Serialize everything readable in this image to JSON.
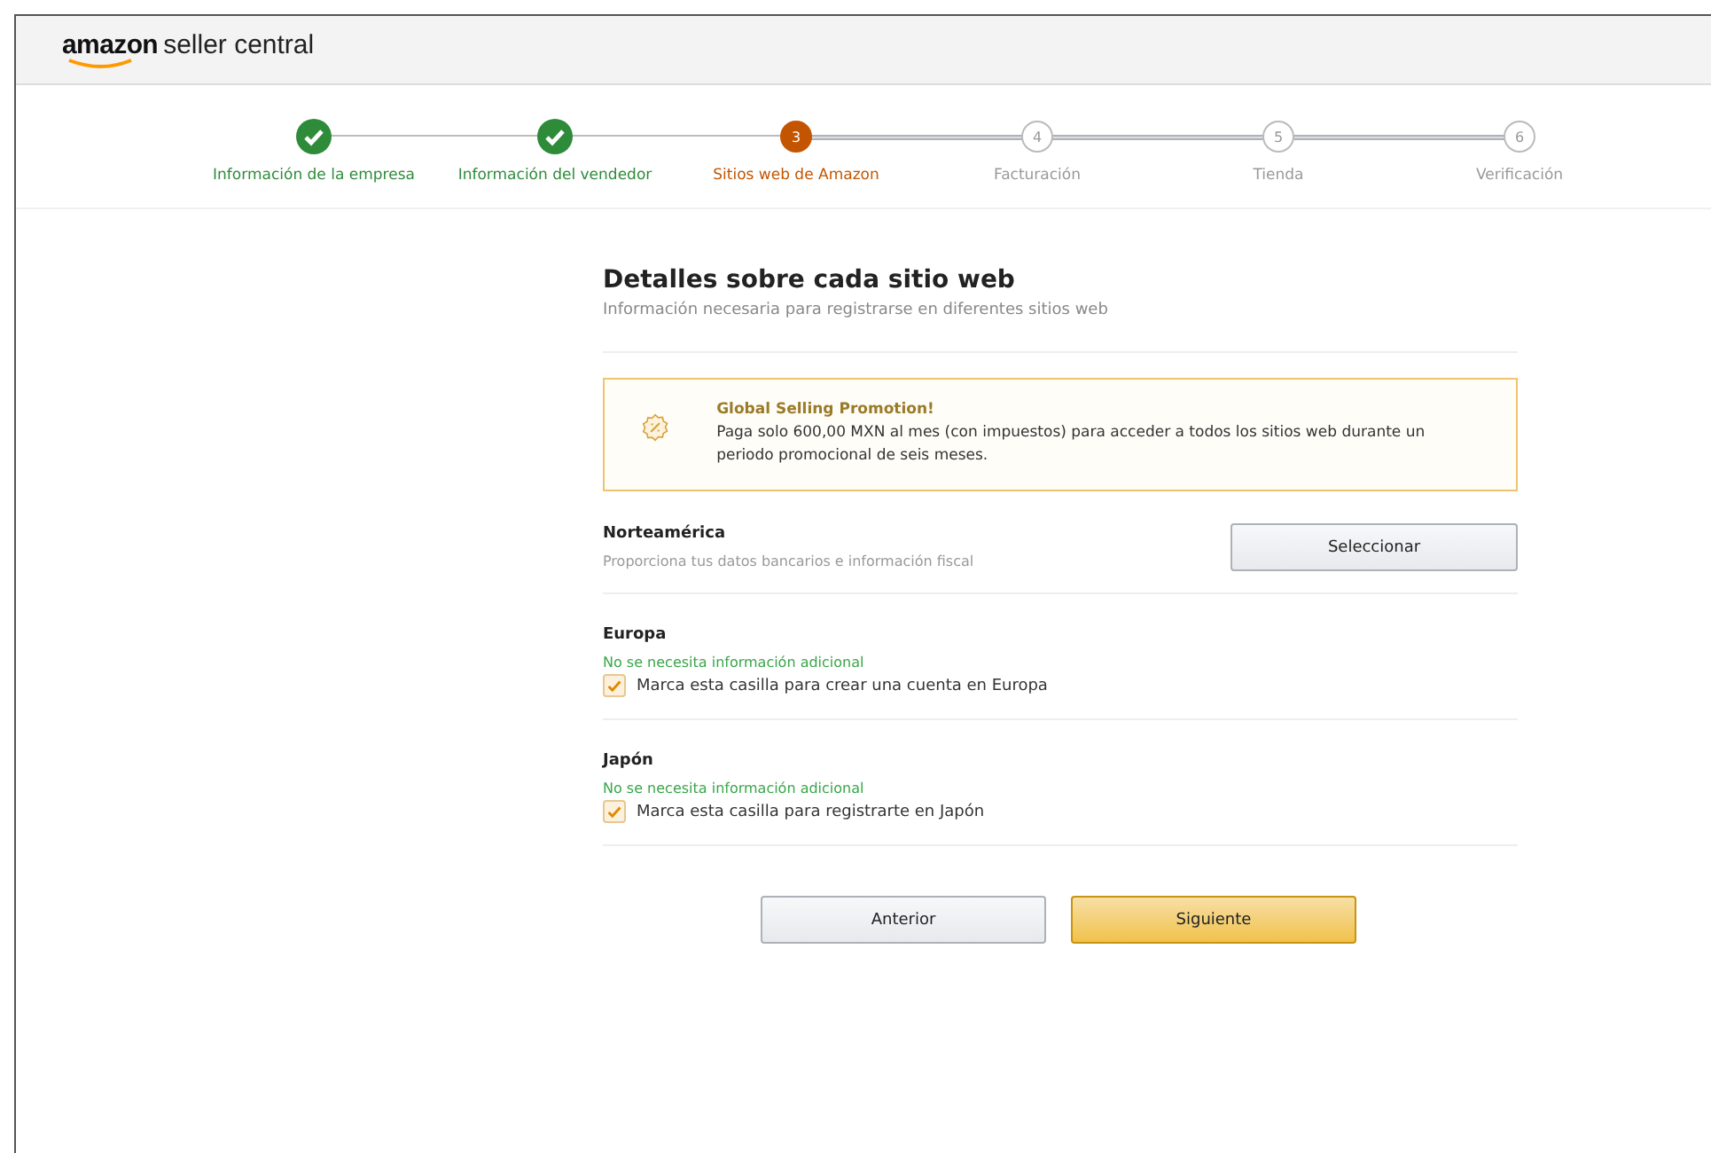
{
  "header": {
    "logo_brand": "amazon",
    "logo_product": "seller central"
  },
  "steps": [
    {
      "label": "Información de la empresa",
      "completed": true,
      "selected": false
    },
    {
      "label": "Información del vendedor",
      "completed": true,
      "selected": false
    },
    {
      "label": "Sitios web de Amazon",
      "completed": false,
      "selected": true,
      "number": "3"
    },
    {
      "label": "Facturación",
      "completed": false,
      "selected": false,
      "number": "4"
    },
    {
      "label": "Tienda",
      "completed": false,
      "selected": false,
      "number": "5"
    },
    {
      "label": "Verificación",
      "completed": false,
      "selected": false,
      "number": "6"
    }
  ],
  "section": {
    "title": "Detalles sobre cada sitio web",
    "subtitle": "Información necesaria para registrarse en diferentes sitios web"
  },
  "promo": {
    "title": "Global Selling Promotion!",
    "text": "Paga solo 600,00 MXN al mes (con impuestos) para acceder a todos los sitios web durante un periodo promocional de seis meses."
  },
  "regions": [
    {
      "kind": "select",
      "name": "Norteamérica",
      "description": "Proporciona tus datos bancarios e información fiscal",
      "button": "Seleccionar"
    },
    {
      "kind": "checkbox",
      "name": "Europa",
      "note": "No se necesita información adicional",
      "checkbox_label": "Marca esta casilla para crear una cuenta en Europa",
      "checked": true
    },
    {
      "kind": "checkbox",
      "name": "Japón",
      "note": "No se necesita información adicional",
      "checkbox_label": "Marca esta casilla para registrarte en Japón",
      "checked": true
    }
  ],
  "buttons": {
    "back": "Anterior",
    "next": "Siguiente"
  }
}
